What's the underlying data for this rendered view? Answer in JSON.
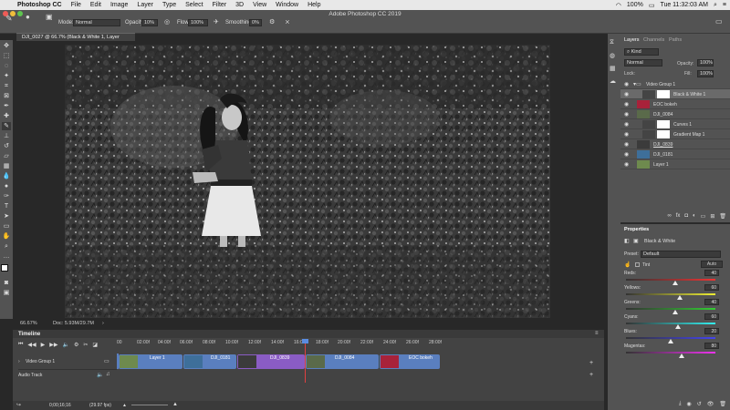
{
  "menubar": {
    "app": "Photoshop CC",
    "items": [
      "File",
      "Edit",
      "Image",
      "Layer",
      "Type",
      "Select",
      "Filter",
      "3D",
      "View",
      "Window",
      "Help"
    ],
    "battery": "100%",
    "clock": "Tue 11:32:03 AM"
  },
  "app_title": "Adobe Photoshop CC 2019",
  "options_bar": {
    "mode_label": "Mode:",
    "mode_value": "Normal",
    "opacity_label": "Opacity:",
    "opacity_value": "10%",
    "flow_label": "Flow:",
    "flow_value": "100%",
    "smoothing_label": "Smoothing:",
    "smoothing_value": "0%"
  },
  "document": {
    "tab_title": "DJI_0027 @ 66.7% (Black & White 1, Layer Mask/8) *",
    "zoom": "66.67%",
    "doc_size": "Doc: 5.93M/29.7M"
  },
  "timeline": {
    "title": "Timeline",
    "ruler": [
      "00",
      "02:00f",
      "04:00f",
      "06:00f",
      "08:00f",
      "10:00f",
      "12:00f",
      "14:00f",
      "16:00f",
      "18:00f",
      "20:00f",
      "22:00f",
      "24:00f",
      "26:00f",
      "28:00f"
    ],
    "video_group": "Video Group 1",
    "audio_track": "Audio Track",
    "clips": [
      "Layer 1",
      "DJI_0181",
      "DJI_0839",
      "DJI_0084",
      "EOC bokeh"
    ],
    "timecode": "0;00;16;16",
    "fps": "(29.97 fps)"
  },
  "panels": {
    "tabs": [
      "Layers",
      "Channels",
      "Paths"
    ],
    "kind": "Kind",
    "blend": "Normal",
    "opacity_label": "Opacity:",
    "opacity_value": "100%",
    "lock_label": "Lock:",
    "fill_label": "Fill:",
    "fill_value": "100%"
  },
  "layers": [
    {
      "name": "Video Group 1",
      "color": "#535353"
    },
    {
      "name": "Black & White 1",
      "color": "#6a6a6a"
    },
    {
      "name": "EOC bokeh",
      "color": "#535353"
    },
    {
      "name": "DJI_0084",
      "color": "#535353"
    },
    {
      "name": "Curves 1",
      "color": "#535353"
    },
    {
      "name": "Gradient Map 1",
      "color": "#535353"
    },
    {
      "name": "DJI_0839",
      "color": "#535353"
    },
    {
      "name": "DJI_0181",
      "color": "#535353"
    },
    {
      "name": "Layer 1",
      "color": "#535353"
    }
  ],
  "properties": {
    "title": "Properties",
    "adjustment": "Black & White",
    "preset_label": "Preset:",
    "preset_value": "Default",
    "tint": "Tint",
    "auto": "Auto",
    "sliders": [
      {
        "name": "Reds:",
        "value": "40",
        "fraction": 0.55
      },
      {
        "name": "Yellows:",
        "value": "60",
        "fraction": 0.6
      },
      {
        "name": "Greens:",
        "value": "40",
        "fraction": 0.55
      },
      {
        "name": "Cyans:",
        "value": "60",
        "fraction": 0.58
      },
      {
        "name": "Blues:",
        "value": "20",
        "fraction": 0.5
      },
      {
        "name": "Magentas:",
        "value": "80",
        "fraction": 0.62
      }
    ]
  },
  "colors": {
    "accent": "#4a78c8",
    "video_clip": "#5a7fbf",
    "purple_clip": "#8a5cc4",
    "playhead": "#e04040"
  }
}
